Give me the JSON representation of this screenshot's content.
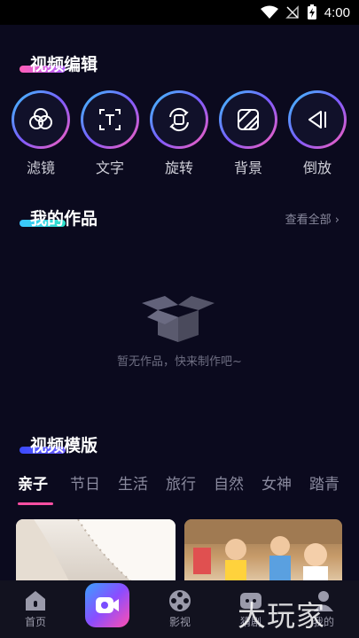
{
  "status_bar": {
    "time": "4:00"
  },
  "video_edit": {
    "title": "视频编辑",
    "tools": [
      {
        "label": "滤镜",
        "icon": "filter-icon"
      },
      {
        "label": "文字",
        "icon": "text-icon"
      },
      {
        "label": "旋转",
        "icon": "rotate-icon"
      },
      {
        "label": "背景",
        "icon": "background-icon"
      },
      {
        "label": "倒放",
        "icon": "reverse-play-icon"
      }
    ]
  },
  "my_works": {
    "title": "我的作品",
    "see_all": "查看全部 ›",
    "empty_text": "暂无作品，快来制作吧~"
  },
  "templates": {
    "title": "视频模版",
    "tabs": [
      "亲子",
      "节日",
      "生活",
      "旅行",
      "自然",
      "女神",
      "踏青"
    ],
    "active_tab": "亲子"
  },
  "bottom_nav": {
    "items": [
      {
        "label": "首页",
        "icon": "home-icon"
      },
      {
        "label": "",
        "icon": "video-camera-icon"
      },
      {
        "label": "影视",
        "icon": "film-reel-icon"
      },
      {
        "label": "猜剧",
        "icon": "guess-icon"
      },
      {
        "label": "我的",
        "icon": "profile-icon"
      }
    ]
  },
  "watermark": "大玩家",
  "colors": {
    "background": "#0b0a1e",
    "accent_pink": "#ff4fa3",
    "accent_cyan": "#3cc6ff",
    "accent_blue": "#4a5cff"
  }
}
